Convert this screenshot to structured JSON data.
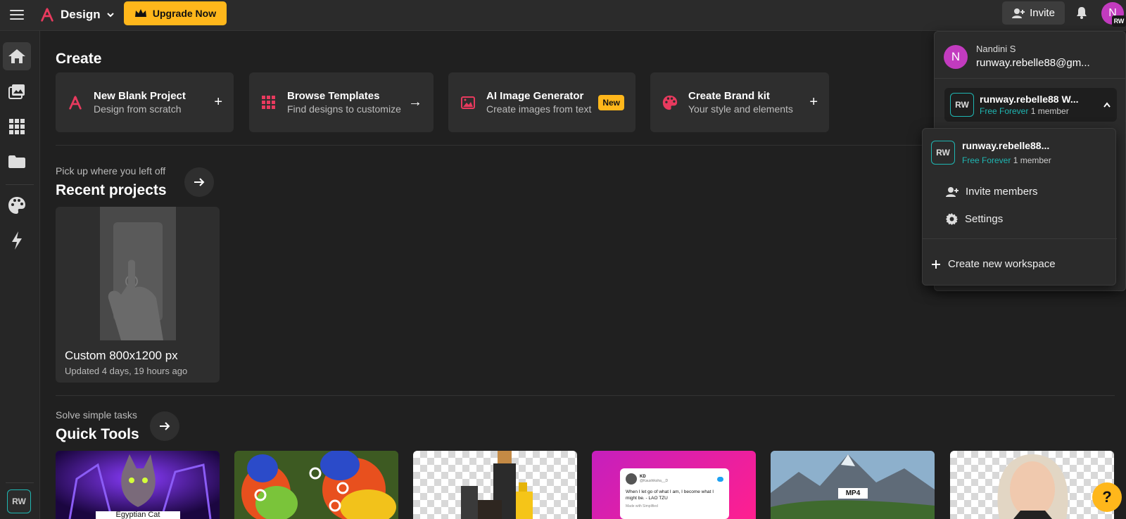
{
  "header": {
    "brand": "Design",
    "upgrade_label": "Upgrade Now",
    "invite_label": "Invite",
    "avatar_initial": "N",
    "avatar_badge": "RW"
  },
  "sidebar": {
    "items": [
      "home-icon",
      "media-icon",
      "apps-icon",
      "folder-icon",
      "palette-icon",
      "bolt-icon"
    ],
    "workspace_badge": "RW"
  },
  "create": {
    "title": "Create",
    "cards": [
      {
        "title": "New Blank Project",
        "subtitle": "Design from scratch",
        "action": "+"
      },
      {
        "title": "Browse Templates",
        "subtitle": "Find designs to customize",
        "action": "→"
      },
      {
        "title": "AI Image Generator",
        "subtitle": "Create images from text",
        "badge": "New"
      },
      {
        "title": "Create Brand kit",
        "subtitle": "Your style and elements",
        "action": "+"
      }
    ]
  },
  "recent": {
    "eyebrow": "Pick up where you left off",
    "title": "Recent projects",
    "project": {
      "name": "Custom 800x1200 px",
      "updated": "Updated 4 days, 19 hours ago"
    }
  },
  "quick_tools": {
    "eyebrow": "Solve simple tasks",
    "title": "Quick Tools",
    "tweet_handle": "KD",
    "tweet_user": "@Kaushiksha__D",
    "tweet_text": "When I let go of what I am, I become what I might be. - LAO TZU",
    "tweet_footer": "Made with Simplified",
    "mp4_label": "MP4",
    "cat_caption": "Egyptian Cat"
  },
  "account": {
    "avatar_initial": "N",
    "name": "Nandini S",
    "email": "runway.rebelle88@gm...",
    "workspace_badge": "RW",
    "workspace_name": "runway.rebelle88 W...",
    "plan": "Free Forever",
    "members": "1 member"
  },
  "workspace_menu": {
    "badge": "RW",
    "name": "runway.rebelle88...",
    "plan": "Free Forever",
    "members": "1 member",
    "invite_label": "Invite members",
    "settings_label": "Settings",
    "create_label": "Create new workspace"
  },
  "colors": {
    "accent": "#ffb71b",
    "teal": "#1fb6b2",
    "pink": "#e83a5e",
    "avatar": "#c23bbf"
  }
}
